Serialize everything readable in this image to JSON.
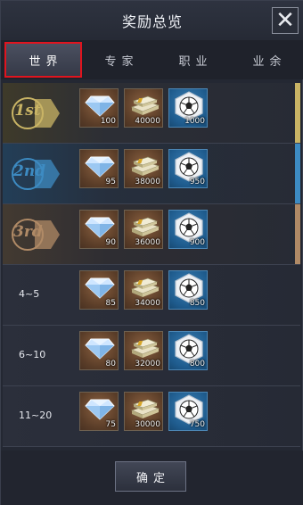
{
  "header": {
    "title": "奖励总览",
    "close_icon": "close-icon"
  },
  "tabs": [
    {
      "label": "世界",
      "active": true
    },
    {
      "label": "专家",
      "active": false
    },
    {
      "label": "职业",
      "active": false
    },
    {
      "label": "业余",
      "active": false
    }
  ],
  "rows": [
    {
      "rank": "1st",
      "badge": true,
      "color": "#c9b465",
      "items": [
        {
          "icon": "diamond-icon",
          "qty": "100"
        },
        {
          "icon": "cash-stack-icon",
          "qty": "40000"
        },
        {
          "icon": "football-icon",
          "qty": "1000"
        }
      ]
    },
    {
      "rank": "2nd",
      "badge": true,
      "color": "#3d8bc2",
      "items": [
        {
          "icon": "diamond-icon",
          "qty": "95"
        },
        {
          "icon": "cash-stack-icon",
          "qty": "38000"
        },
        {
          "icon": "football-icon",
          "qty": "950"
        }
      ]
    },
    {
      "rank": "3rd",
      "badge": true,
      "color": "#b08a66",
      "items": [
        {
          "icon": "diamond-icon",
          "qty": "90"
        },
        {
          "icon": "cash-stack-icon",
          "qty": "36000"
        },
        {
          "icon": "football-icon",
          "qty": "900"
        }
      ]
    },
    {
      "rank": "4~5",
      "badge": false,
      "items": [
        {
          "icon": "diamond-icon",
          "qty": "85"
        },
        {
          "icon": "cash-stack-icon",
          "qty": "34000"
        },
        {
          "icon": "football-icon",
          "qty": "850"
        }
      ]
    },
    {
      "rank": "6~10",
      "badge": false,
      "items": [
        {
          "icon": "diamond-icon",
          "qty": "80"
        },
        {
          "icon": "cash-stack-icon",
          "qty": "32000"
        },
        {
          "icon": "football-icon",
          "qty": "800"
        }
      ]
    },
    {
      "rank": "11~20",
      "badge": false,
      "items": [
        {
          "icon": "diamond-icon",
          "qty": "75"
        },
        {
          "icon": "cash-stack-icon",
          "qty": "30000"
        },
        {
          "icon": "football-icon",
          "qty": "750"
        }
      ]
    }
  ],
  "footer": {
    "confirm_label": "确定"
  }
}
